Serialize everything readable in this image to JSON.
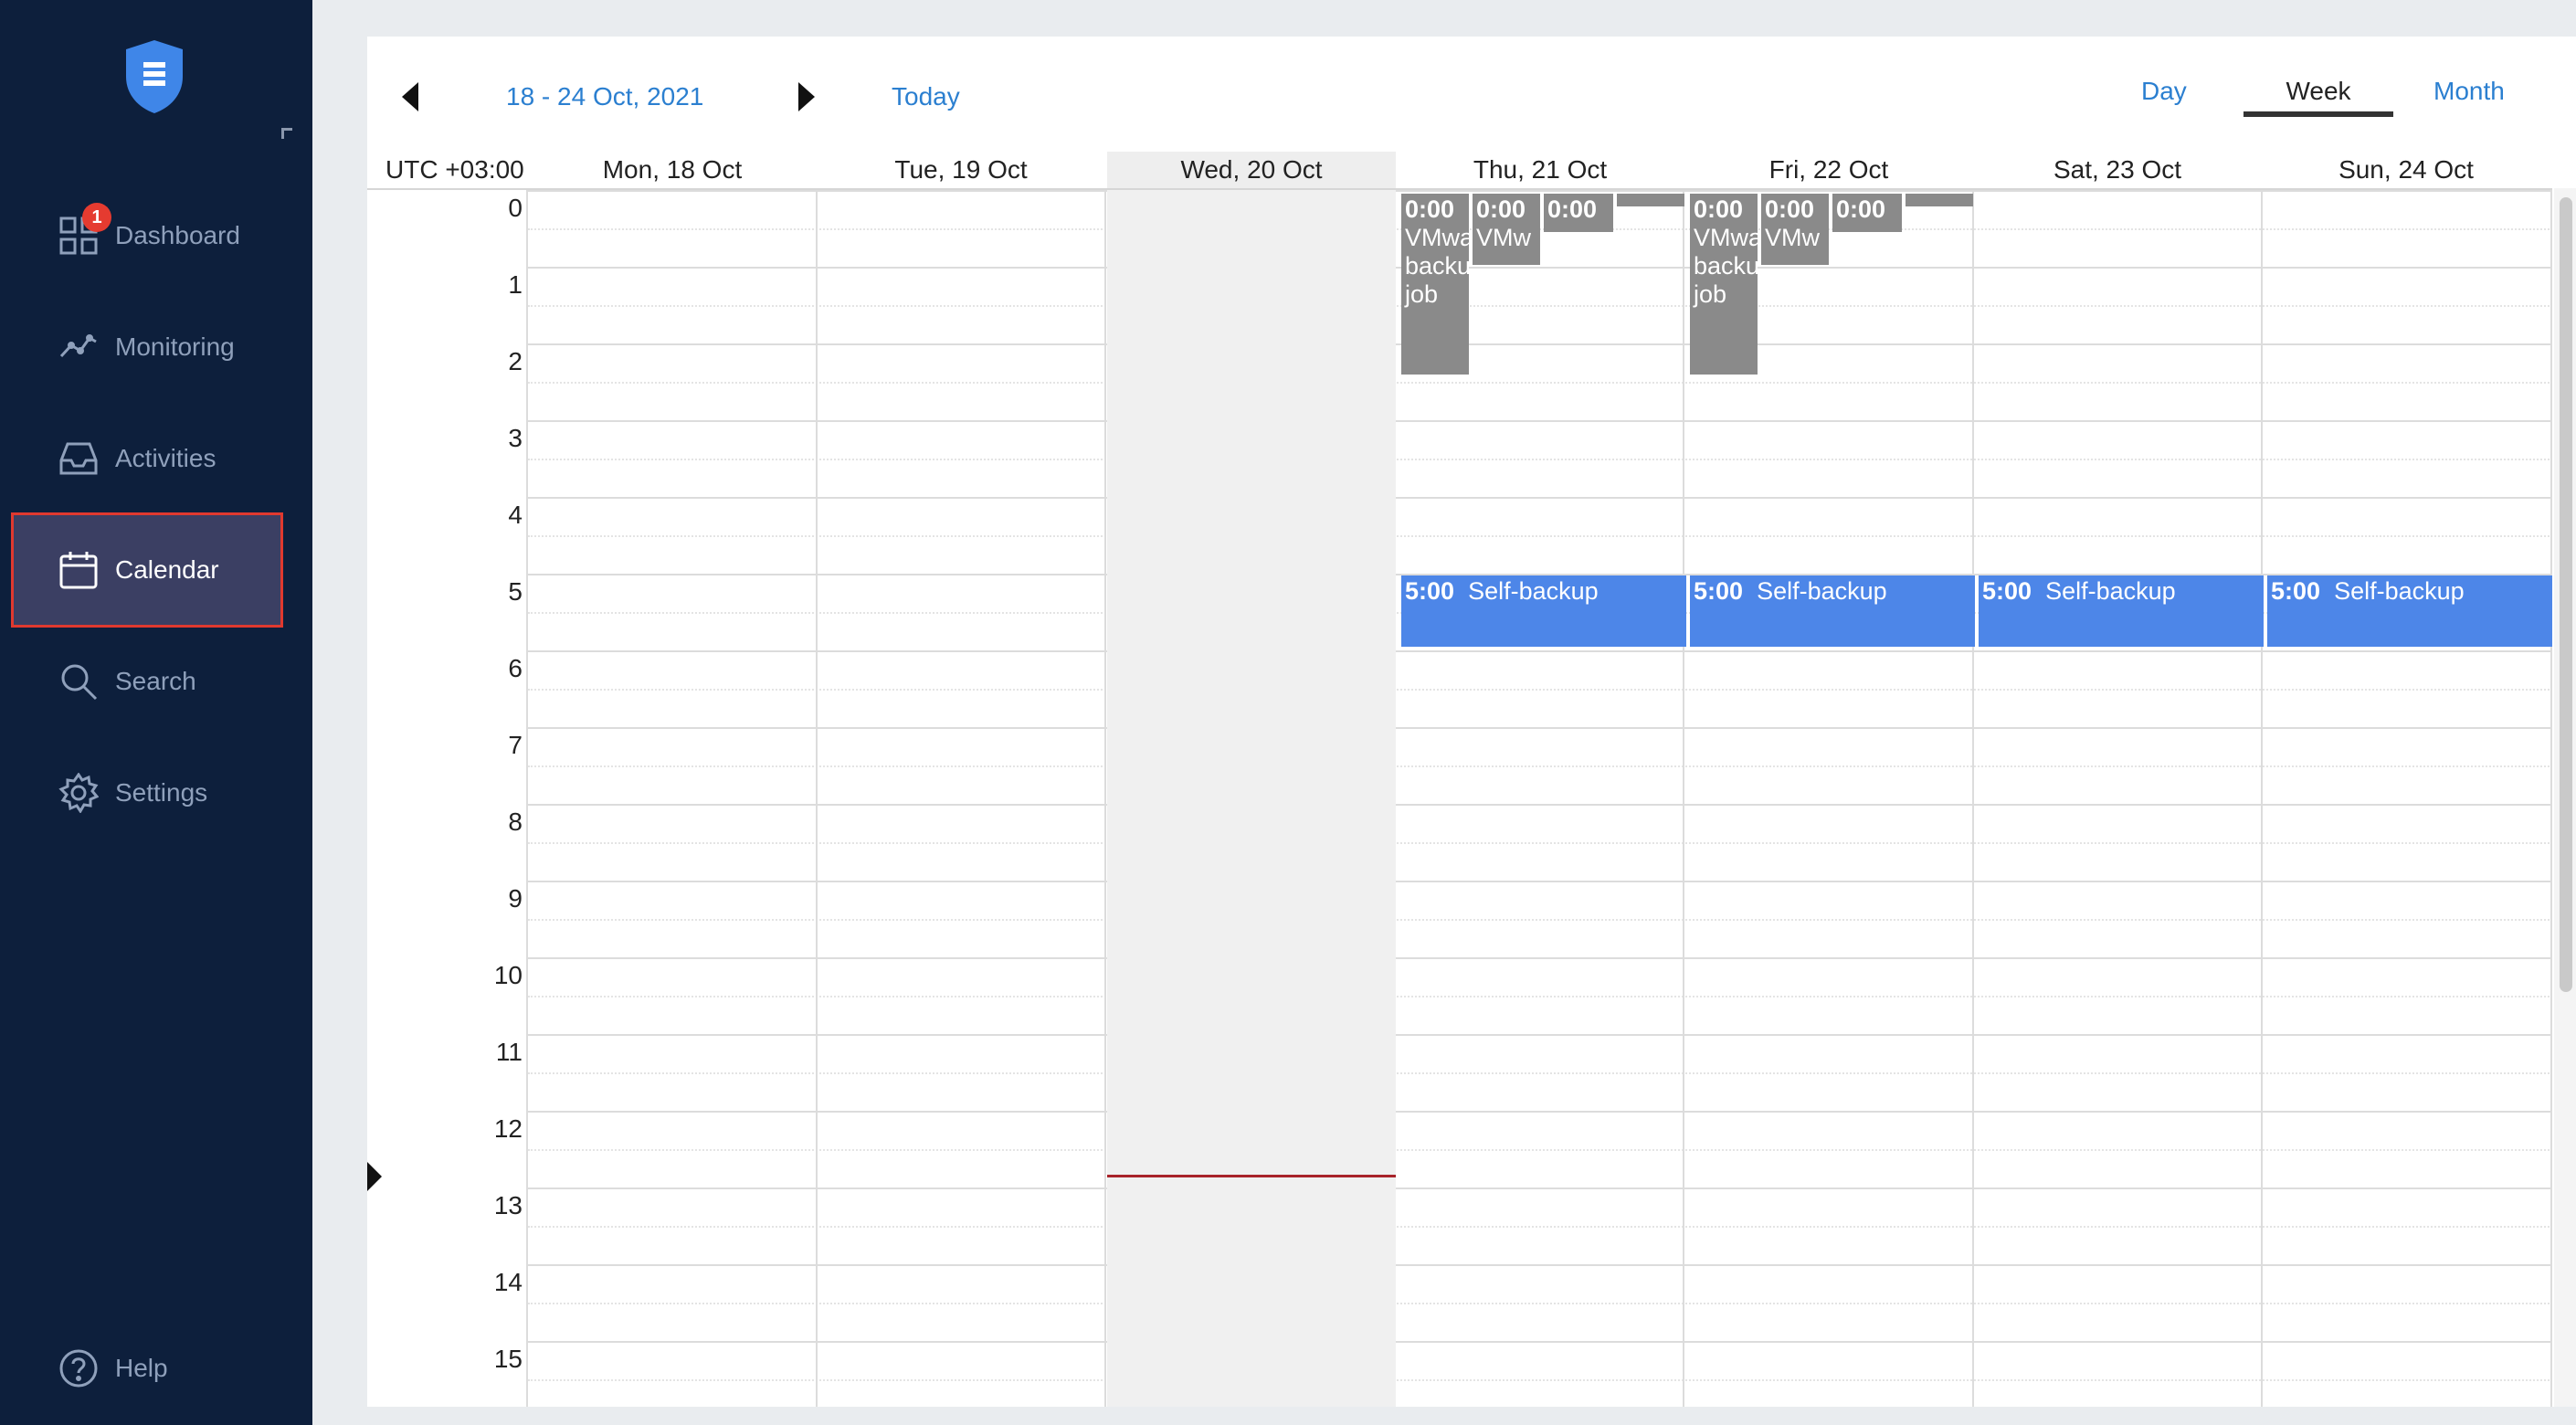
{
  "sidebar": {
    "items": [
      {
        "key": "dashboard",
        "label": "Dashboard",
        "icon": "dashboard-grid-icon",
        "badge": "1"
      },
      {
        "key": "monitoring",
        "label": "Monitoring",
        "icon": "monitoring-chart-icon"
      },
      {
        "key": "activities",
        "label": "Activities",
        "icon": "activities-inbox-icon"
      },
      {
        "key": "calendar",
        "label": "Calendar",
        "icon": "calendar-icon",
        "active": true
      },
      {
        "key": "search",
        "label": "Search",
        "icon": "search-icon"
      },
      {
        "key": "settings",
        "label": "Settings",
        "icon": "gear-icon"
      }
    ],
    "help_label": "Help",
    "help_icon": "help-circle-icon",
    "logo_icon": "shield-logo-icon"
  },
  "toolbar": {
    "date_range": "18 - 24 Oct, 2021",
    "today_label": "Today",
    "views": [
      "Day",
      "Week",
      "Month"
    ],
    "active_view": "Week"
  },
  "calendar": {
    "timezone": "UTC +03:00",
    "days": [
      "Mon, 18 Oct",
      "Tue, 19 Oct",
      "Wed, 20 Oct",
      "Thu, 21 Oct",
      "Fri, 22 Oct",
      "Sat, 23 Oct",
      "Sun, 24 Oct"
    ],
    "today_index": 2,
    "hours": [
      "0",
      "1",
      "2",
      "3",
      "4",
      "5",
      "6",
      "7",
      "8",
      "9",
      "10",
      "11",
      "12",
      "13",
      "14",
      "15"
    ],
    "events": {
      "thu_vmware_1": {
        "time": "0:00",
        "title": "VMware backup job"
      },
      "thu_vmware_2": {
        "time": "0:00",
        "title": "VMw"
      },
      "thu_vmware_3": {
        "time": "0:00",
        "title": ""
      },
      "fri_vmware_1": {
        "time": "0:00",
        "title": "VMware backup job"
      },
      "fri_vmware_2": {
        "time": "0:00",
        "title": "VMw"
      },
      "fri_vmware_3": {
        "time": "0:00",
        "title": ""
      },
      "thu_self_backup": {
        "time": "5:00",
        "title": "Self-backup"
      },
      "fri_self_backup": {
        "time": "5:00",
        "title": "Self-backup"
      },
      "sat_self_backup": {
        "time": "5:00",
        "title": "Self-backup"
      },
      "sun_self_backup": {
        "time": "5:00",
        "title": "Self-backup"
      }
    }
  },
  "colors": {
    "sidebar_bg": "#0d1f3c",
    "accent_link": "#2b7fd0",
    "event_blue": "#4d86e8",
    "event_grey": "#8a8a8a",
    "now_line": "#a8232a",
    "active_outline": "#e0392f"
  }
}
